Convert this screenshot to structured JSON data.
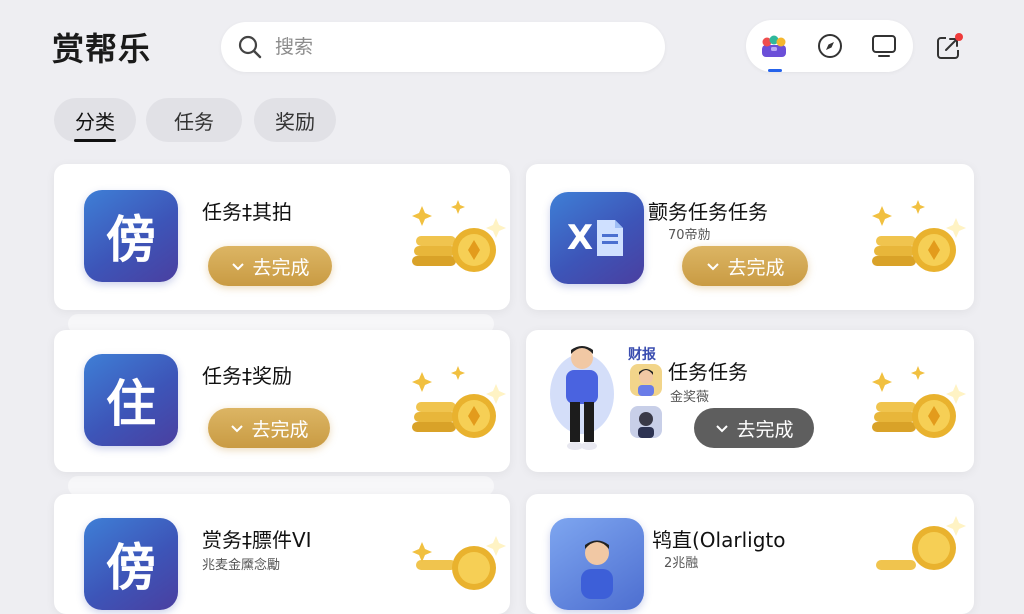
{
  "header": {
    "app_title": "赏帮乐",
    "search_placeholder": "搜索"
  },
  "nav": {
    "icons": [
      "apps-icon",
      "compass-icon",
      "tv-icon"
    ],
    "share_icon": "share-icon"
  },
  "tabs": [
    {
      "label": "分类",
      "active": true
    },
    {
      "label": "任务"
    },
    {
      "label": "奖励"
    }
  ],
  "cards": [
    {
      "icon_text": "傍",
      "title": "任务‡其拍",
      "button": "去完成"
    },
    {
      "icon_text": "X",
      "title": "颤务任务任务",
      "subtitle": "70帝勍",
      "button": "去完成"
    },
    {
      "icon_text": "住",
      "title": "任务‡奖励",
      "button": "去完成"
    },
    {
      "corner_label": "财报",
      "title": "任务任务",
      "subtitle": "金奖薇",
      "button": "去完成"
    },
    {
      "icon_text": "傍",
      "title": "赏务‡膘件VI",
      "subtitle": "兆麦金黡念勵"
    },
    {
      "title": "鸨直(Olarligto",
      "subtitle": "2兆融"
    }
  ],
  "colors": {
    "accent": "#2563eb",
    "gold_button": "#d1a650",
    "gray_button": "#5e5e5e"
  }
}
